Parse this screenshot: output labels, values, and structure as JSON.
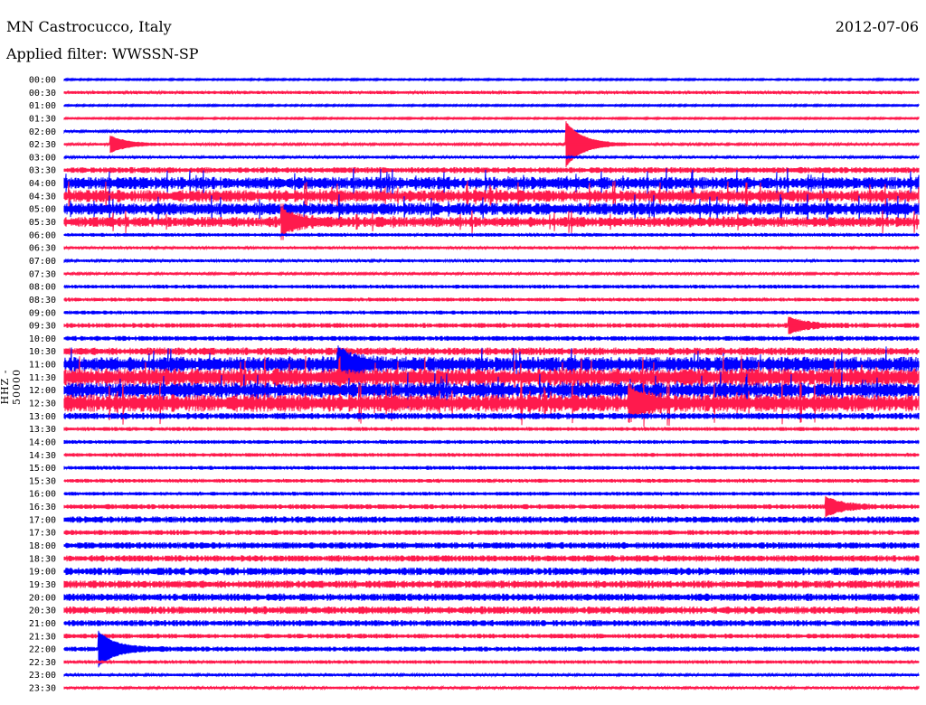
{
  "header": {
    "station": "MN Castrocucco, Italy",
    "filter": "Applied filter: WWSSN-SP",
    "date": "2012-07-06"
  },
  "chart_data": {
    "type": "line",
    "title": "MN Castrocucco, Italy",
    "ylabel": "HHZ - 50000",
    "xrange_minutes": [
      0,
      30
    ],
    "colors": [
      "#0000ff",
      "#ff1a4d"
    ],
    "rows": [
      "00:00",
      "00:30",
      "01:00",
      "01:30",
      "02:00",
      "02:30",
      "03:00",
      "03:30",
      "04:00",
      "04:30",
      "05:00",
      "05:30",
      "06:00",
      "06:30",
      "07:00",
      "07:30",
      "08:00",
      "08:30",
      "09:00",
      "09:30",
      "10:00",
      "10:30",
      "11:00",
      "11:30",
      "12:00",
      "12:30",
      "13:00",
      "13:30",
      "14:00",
      "14:30",
      "15:00",
      "15:30",
      "16:00",
      "16:30",
      "17:00",
      "17:30",
      "18:00",
      "18:30",
      "19:00",
      "19:30",
      "20:00",
      "20:30",
      "21:00",
      "21:30",
      "22:00",
      "22:30",
      "23:00",
      "23:30"
    ],
    "noise_levels": [
      0.6,
      1.2,
      0.6,
      0.6,
      1.0,
      0.9,
      1.0,
      2.2,
      4.5,
      4.5,
      4.5,
      3.8,
      1.3,
      1.1,
      1.1,
      0.9,
      1.4,
      1.4,
      1.4,
      1.8,
      1.8,
      2.8,
      5.5,
      6.5,
      5.5,
      6.5,
      2.4,
      1.4,
      1.4,
      1.4,
      1.4,
      1.4,
      1.4,
      1.8,
      2.4,
      1.9,
      2.4,
      2.4,
      2.8,
      2.8,
      2.8,
      2.8,
      2.3,
      1.8,
      1.8,
      1.3,
      1.0,
      1.0
    ],
    "events": [
      {
        "row": "02:30",
        "minute": 1.6,
        "amplitude": 9
      },
      {
        "row": "02:30",
        "minute": 17.6,
        "amplitude": 25
      },
      {
        "row": "05:30",
        "minute": 7.6,
        "amplitude": 12
      },
      {
        "row": "09:30",
        "minute": 25.4,
        "amplitude": 9
      },
      {
        "row": "11:00",
        "minute": 9.6,
        "amplitude": 14
      },
      {
        "row": "12:30",
        "minute": 19.8,
        "amplitude": 14
      },
      {
        "row": "16:30",
        "minute": 26.7,
        "amplitude": 10
      },
      {
        "row": "22:00",
        "minute": 1.2,
        "amplitude": 18
      }
    ]
  }
}
